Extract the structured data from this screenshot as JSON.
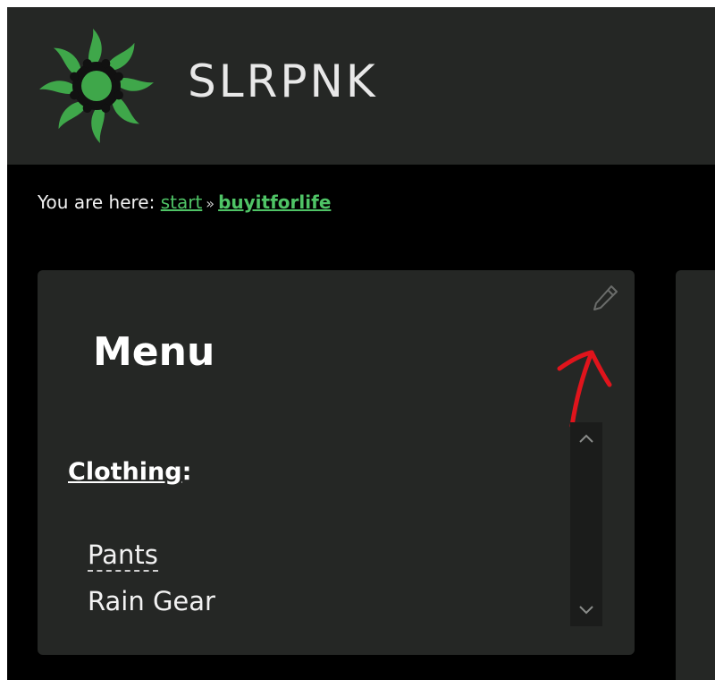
{
  "site": {
    "title": "SLRPNK",
    "logo_icon": "sun-logo-icon",
    "accent": "#3fa74a"
  },
  "breadcrumb": {
    "prefix": "You are here:",
    "items": [
      {
        "label": "start"
      },
      {
        "label": "buyitforlife"
      }
    ],
    "separator": "»"
  },
  "sidebar": {
    "title": "Menu",
    "edit_icon": "pencil-icon",
    "annotation_color": "#e0141c",
    "section": {
      "label": "Clothing",
      "suffix": ":"
    },
    "items": [
      {
        "label": "Pants"
      },
      {
        "label": "Rain Gear"
      }
    ],
    "scroll_up_icon": "chevron-up-icon",
    "scroll_down_icon": "chevron-down-icon"
  }
}
